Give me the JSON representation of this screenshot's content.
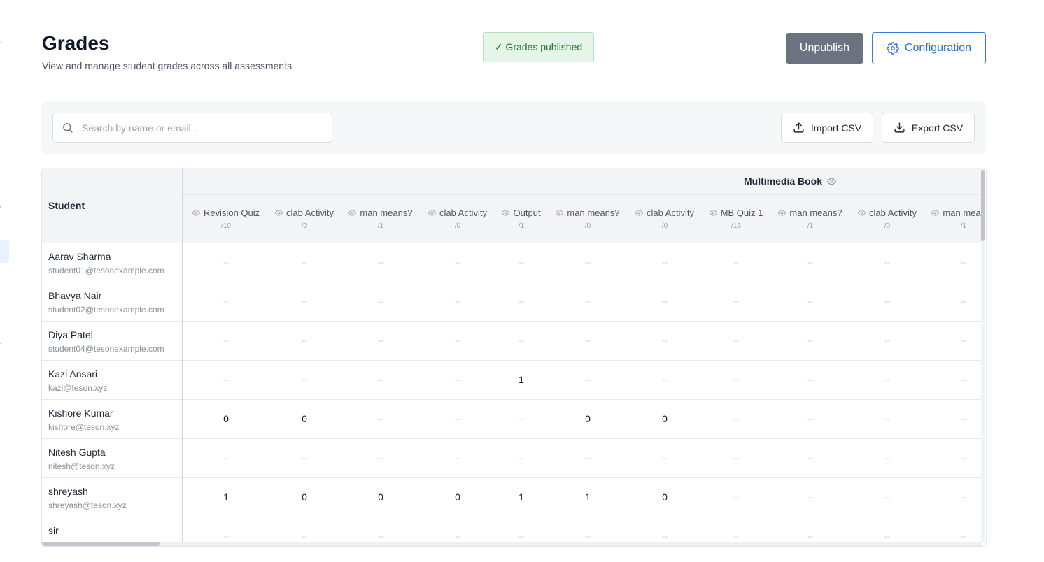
{
  "header": {
    "title": "Grades",
    "subtitle": "View and manage student grades across all assessments",
    "status_badge": "✓ Grades published",
    "unpublish_label": "Unpublish",
    "configuration_label": "Configuration"
  },
  "toolbar": {
    "search_placeholder": "Search by name or email...",
    "search_value": "",
    "import_label": "Import CSV",
    "export_label": "Export CSV"
  },
  "table": {
    "student_header": "Student",
    "group_title": "Multimedia Book",
    "columns": [
      {
        "title": "Revision Quiz",
        "max": "/10"
      },
      {
        "title": "clab Activity",
        "max": "/0"
      },
      {
        "title": "man means?",
        "max": "/1"
      },
      {
        "title": "clab Activity",
        "max": "/0"
      },
      {
        "title": "Output",
        "max": "/1"
      },
      {
        "title": "man means?",
        "max": "/0"
      },
      {
        "title": "clab Activity",
        "max": "/0"
      },
      {
        "title": "MB Quiz 1",
        "max": "/13"
      },
      {
        "title": "man means?",
        "max": "/1"
      },
      {
        "title": "clab Activity",
        "max": "/0"
      },
      {
        "title": "man means?",
        "max": "/1"
      }
    ],
    "rows": [
      {
        "name": "Aarav Sharma",
        "email": "student01@tesonexample.com",
        "grades": [
          "--",
          "--",
          "--",
          "--",
          "--",
          "--",
          "--",
          "--",
          "--",
          "--",
          "--"
        ]
      },
      {
        "name": "Bhavya Nair",
        "email": "student02@tesonexample.com",
        "grades": [
          "--",
          "--",
          "--",
          "--",
          "--",
          "--",
          "--",
          "--",
          "--",
          "--",
          "--"
        ]
      },
      {
        "name": "Diya Patel",
        "email": "student04@tesonexample.com",
        "grades": [
          "--",
          "--",
          "--",
          "--",
          "--",
          "--",
          "--",
          "--",
          "--",
          "--",
          "--"
        ]
      },
      {
        "name": "Kazi Ansari",
        "email": "kazi@teson.xyz",
        "grades": [
          "--",
          "--",
          "--",
          "--",
          "1",
          "--",
          "--",
          "--",
          "--",
          "--",
          "--"
        ]
      },
      {
        "name": "Kishore Kumar",
        "email": "kishore@teson.xyz",
        "grades": [
          "0",
          "0",
          "--",
          "--",
          "--",
          "0",
          "0",
          "--",
          "--",
          "--",
          "--"
        ]
      },
      {
        "name": "Nitesh Gupta",
        "email": "nitesh@teson.xyz",
        "grades": [
          "--",
          "--",
          "--",
          "--",
          "--",
          "--",
          "--",
          "--",
          "--",
          "--",
          "--"
        ]
      },
      {
        "name": "shreyash",
        "email": "shreyash@teson.xyz",
        "grades": [
          "1",
          "0",
          "0",
          "0",
          "1",
          "1",
          "0",
          "--",
          "--",
          "--",
          "--"
        ]
      },
      {
        "name": "sir",
        "email": "",
        "grades": [
          "--",
          "--",
          "--",
          "--",
          "--",
          "--",
          "--",
          "--",
          "--",
          "--",
          "--"
        ]
      }
    ]
  },
  "icons": {
    "search": "search-icon",
    "settings": "gear-icon",
    "upload": "upload-icon",
    "download": "download-icon",
    "visibility": "eye-icon"
  },
  "colors": {
    "accent": "#2b6cde",
    "published_bg": "#e5f5e8",
    "published_text": "#1f7a34",
    "unpublish_bg": "#6b7280"
  }
}
